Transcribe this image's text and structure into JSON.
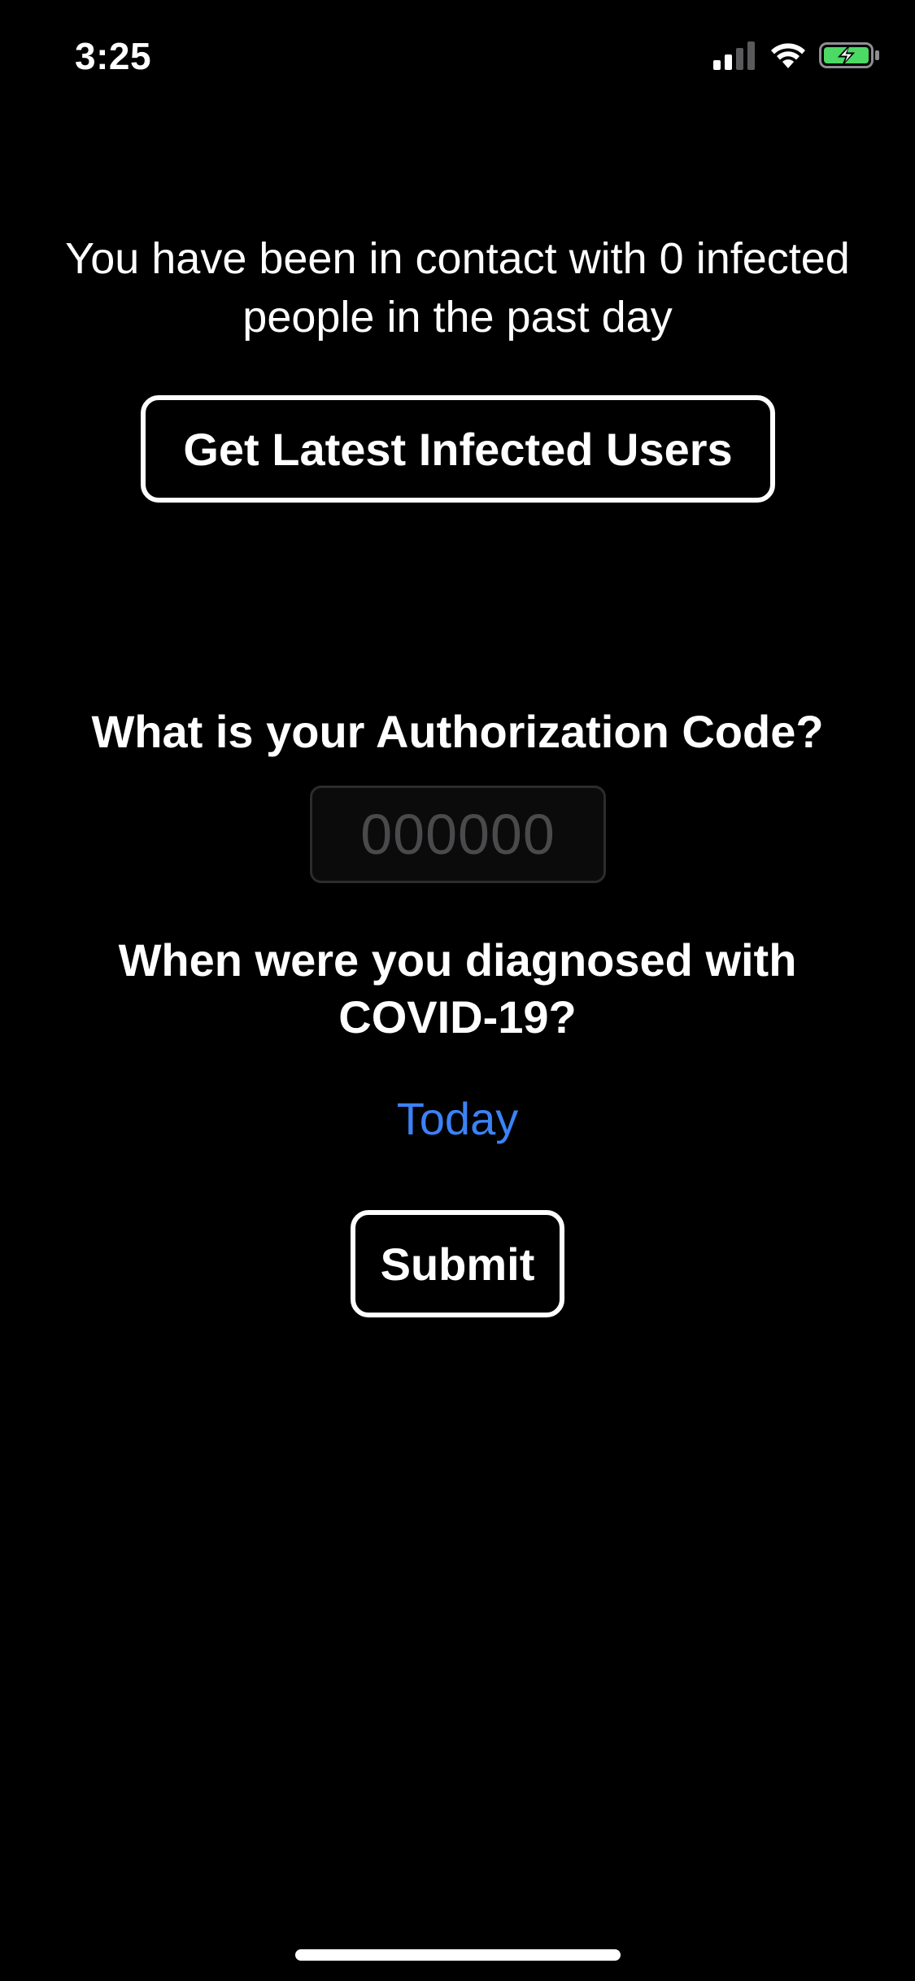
{
  "status_bar": {
    "time": "3:25",
    "icons": [
      "cellular-signal-icon",
      "wifi-icon",
      "battery-charging-icon"
    ],
    "battery_color": "#4cd964"
  },
  "main": {
    "contact_message_line1": "You have been in contact with 0 infected",
    "contact_message_line2": "people in the past day",
    "get_latest_label": "Get Latest Infected Users",
    "auth_question": "What is your Authorization Code?",
    "auth_input": {
      "value": "",
      "placeholder": "000000"
    },
    "diagnosed_question_line1": "When were you diagnosed with",
    "diagnosed_question_line2": "COVID-19?",
    "diagnosis_date": "Today",
    "submit_label": "Submit"
  },
  "colors": {
    "background": "#000000",
    "text": "#ffffff",
    "accent_link": "#3b82f6"
  }
}
